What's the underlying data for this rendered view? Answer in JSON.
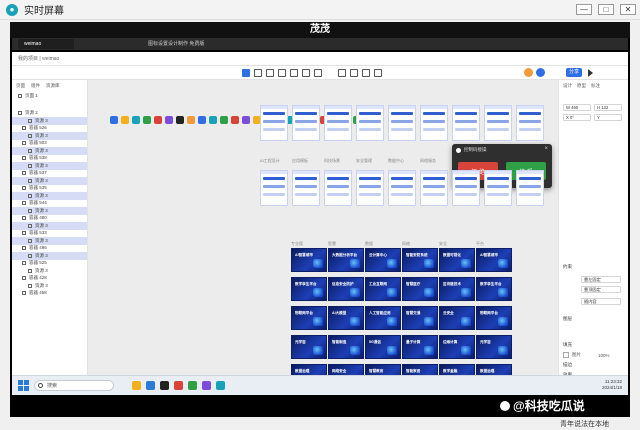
{
  "window": {
    "title": "实时屏幕",
    "controls": [
      "—",
      "□",
      "✕"
    ]
  },
  "stage": {
    "title": "茂茂"
  },
  "browser": {
    "tabs": [
      "weimao",
      "",
      "图标设置设计制作 免费版"
    ]
  },
  "editor": {
    "breadcrumb": "我的项目 | weimao",
    "share_label": "分享",
    "layer_tabs": [
      "页面",
      "组件",
      "资源库"
    ],
    "layer_items": [
      {
        "label": "页面 1",
        "kind": "frame",
        "sel": false
      },
      {
        "label": "资源 2",
        "kind": "frame",
        "sel": false
      },
      {
        "label": "资源 3",
        "kind": "sub",
        "sel": true
      },
      {
        "label": "容器 526",
        "kind": "item",
        "sel": false
      },
      {
        "label": "资源 3",
        "kind": "sub",
        "sel": true
      },
      {
        "label": "容器 503",
        "kind": "item",
        "sel": false
      },
      {
        "label": "资源 3",
        "kind": "sub",
        "sel": true
      },
      {
        "label": "容器 538",
        "kind": "item",
        "sel": false
      },
      {
        "label": "资源 3",
        "kind": "sub",
        "sel": true
      },
      {
        "label": "容器 537",
        "kind": "item",
        "sel": false
      },
      {
        "label": "资源 3",
        "kind": "sub",
        "sel": true
      },
      {
        "label": "容器 535",
        "kind": "item",
        "sel": false
      },
      {
        "label": "资源 3",
        "kind": "sub",
        "sel": true
      },
      {
        "label": "容器 544",
        "kind": "item",
        "sel": false
      },
      {
        "label": "资源 3",
        "kind": "sub",
        "sel": true
      },
      {
        "label": "容器 480",
        "kind": "item",
        "sel": false
      },
      {
        "label": "资源 3",
        "kind": "sub",
        "sel": true
      },
      {
        "label": "容器 533",
        "kind": "item",
        "sel": false
      },
      {
        "label": "资源 3",
        "kind": "sub",
        "sel": true
      },
      {
        "label": "容器 496",
        "kind": "item",
        "sel": false
      },
      {
        "label": "资源 3",
        "kind": "sub",
        "sel": true
      },
      {
        "label": "容器 525",
        "kind": "item",
        "sel": false
      },
      {
        "label": "资源 3",
        "kind": "sub",
        "sel": false
      },
      {
        "label": "容器 428",
        "kind": "item",
        "sel": false
      },
      {
        "label": "资源 3",
        "kind": "sub",
        "sel": false
      },
      {
        "label": "容器 458",
        "kind": "item",
        "sel": false
      }
    ],
    "row1_labels": [
      "AI工程设计",
      "应用模板",
      "科技场景",
      "安全管理",
      "数据中心",
      "网络服务"
    ],
    "dark_labels": [
      "专业版",
      "智慧",
      "数据",
      "网络",
      "安全",
      "平台"
    ],
    "dark_slide_titles": [
      [
        "AI智慧城市",
        "大数据分析平台",
        "云计算中心",
        "智能安防系统",
        "数据可视化"
      ],
      [
        "数字孪生平台",
        "信息安全防护",
        "工业互联网",
        "智慧医疗",
        "区块链技术"
      ],
      [
        "物联网平台",
        "AI大模型",
        "人工智能应用",
        "智慧交通",
        "云安全"
      ],
      [
        "元宇宙",
        "智能制造",
        "5G通信",
        "量子计算",
        "边缘计算"
      ],
      [
        "数据治理",
        "网络安全",
        "智慧教育",
        "智能家居",
        "数字金融"
      ]
    ],
    "props": {
      "tabs": [
        "设计",
        "原型",
        "标注"
      ],
      "fields": [
        [
          "W",
          "460"
        ],
        [
          "H",
          "132"
        ],
        [
          "X",
          "0°"
        ],
        [
          "Y",
          ""
        ]
      ],
      "sections": [
        "约束",
        "图层",
        "填充",
        "描边",
        "效果",
        "导出"
      ],
      "constraint_values": [
        "靠左固定",
        "靠顶固定",
        "随内容"
      ],
      "fill_label": "图片",
      "opacity": "100%"
    }
  },
  "dialog": {
    "title": "控制码接操",
    "close": "×",
    "left_button": "拒 绝",
    "right_button": "接 受"
  },
  "taskbar": {
    "search_placeholder": "搜索",
    "time": "11:23:32",
    "date": "2024/1/18"
  },
  "watermark": "@科技吃瓜说",
  "bottom_text": "青年说法在本地",
  "colors": {
    "accent": "#2f6fe4",
    "danger": "#d9443a",
    "success": "#2fa046"
  }
}
